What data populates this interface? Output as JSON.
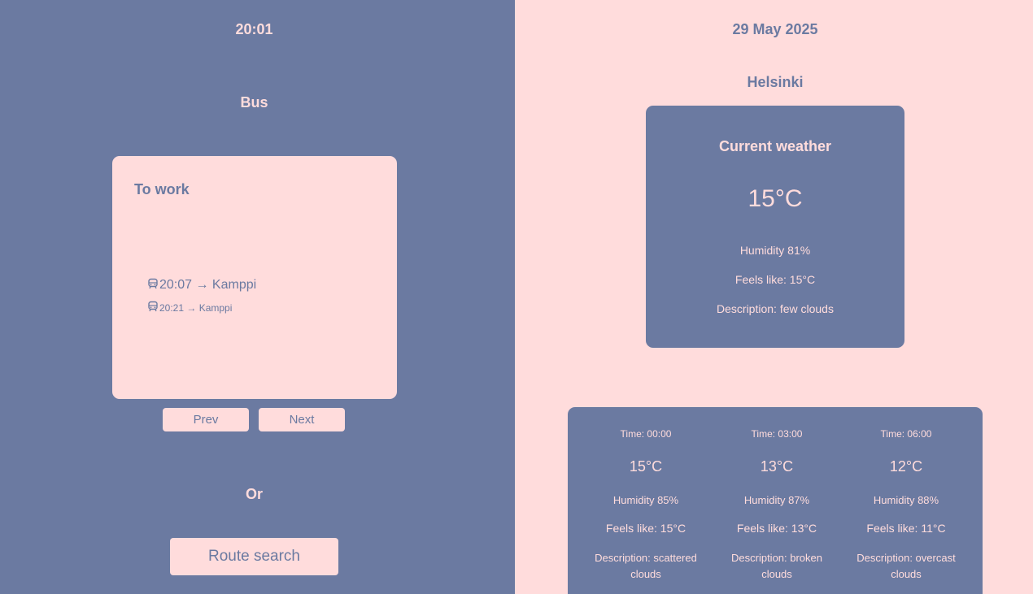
{
  "colors": {
    "slate": "#6b7aa1",
    "pink": "#ffdcdc"
  },
  "left_panel": {
    "clock": "20:01",
    "section_title": "Bus",
    "card": {
      "title": "To work",
      "departures": [
        {
          "icon": "bus-icon",
          "text": "20:07 → Kamppi"
        },
        {
          "icon": "bus-icon",
          "text": "20:21 → Kamppi"
        }
      ]
    },
    "pager": {
      "prev_label": "Prev",
      "next_label": "Next"
    },
    "or_text": "Or",
    "route_search_label": "Route search"
  },
  "right_panel": {
    "date": "29 May 2025",
    "city": "Helsinki",
    "current": {
      "title": "Current weather",
      "temperature": "15°C",
      "humidity": "Humidity 81%",
      "feels_like": "Feels like: 15°C",
      "description": "Description: few clouds"
    },
    "forecast": [
      {
        "time": "Time: 00:00",
        "temperature": "15°C",
        "humidity": "Humidity 85%",
        "feels_like": "Feels like: 15°C",
        "description": "Description: scattered clouds"
      },
      {
        "time": "Time: 03:00",
        "temperature": "13°C",
        "humidity": "Humidity 87%",
        "feels_like": "Feels like: 13°C",
        "description": "Description: broken clouds"
      },
      {
        "time": "Time: 06:00",
        "temperature": "12°C",
        "humidity": "Humidity 88%",
        "feels_like": "Feels like: 11°C",
        "description": "Description: overcast clouds"
      }
    ]
  }
}
